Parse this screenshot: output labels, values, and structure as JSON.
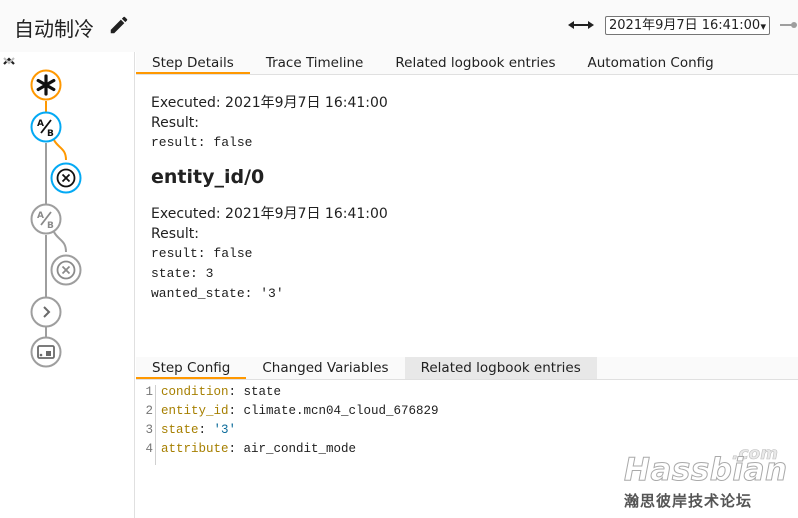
{
  "header": {
    "title": "自动制冷",
    "trace_select_value": "2021年9月7日 16:41:00",
    "icons": {
      "edit": "pencil-icon",
      "range": "double-arrow-icon",
      "next": "next-trace-icon"
    }
  },
  "graph": {
    "nodes": [
      {
        "type": "trigger",
        "icon": "asterisk-icon",
        "state": "active"
      },
      {
        "type": "condition",
        "icon": "choose-icon",
        "state": "active"
      },
      {
        "type": "stop",
        "icon": "close-icon",
        "state": "active"
      },
      {
        "type": "condition",
        "icon": "choose-icon",
        "state": "inactive"
      },
      {
        "type": "stop",
        "icon": "close-icon",
        "state": "inactive"
      },
      {
        "type": "action",
        "icon": "chevron-right-icon",
        "state": "inactive"
      },
      {
        "type": "device",
        "icon": "device-icon",
        "state": "inactive"
      }
    ],
    "colors": {
      "active": "#ff9800",
      "highlight": "#03a9f4",
      "inactive": "#9e9e9e"
    }
  },
  "top_tabs": [
    "Step Details",
    "Trace Timeline",
    "Related logbook entries",
    "Automation Config"
  ],
  "details": {
    "block1": {
      "executed": "Executed: 2021年9月7日 16:41:00",
      "result_label": "Result:",
      "lines": [
        "result: false"
      ]
    },
    "heading": "entity_id/0",
    "block2": {
      "executed": "Executed: 2021年9月7日 16:41:00",
      "result_label": "Result:",
      "lines": [
        "result: false",
        "state: 3",
        "wanted_state: '3'"
      ]
    }
  },
  "bottom_tabs": [
    "Step Config",
    "Changed Variables",
    "Related logbook entries"
  ],
  "config": {
    "lines": [
      {
        "num": "1",
        "key": "condition",
        "sep": ": ",
        "value": "state",
        "is_string": false
      },
      {
        "num": "2",
        "key": "entity_id",
        "sep": ": ",
        "value": "climate.mcn04_cloud_676829",
        "is_string": false
      },
      {
        "num": "3",
        "key": "state",
        "sep": ": ",
        "value": "'3'",
        "is_string": true
      },
      {
        "num": "4",
        "key": "attribute",
        "sep": ": ",
        "value": "air_condit_mode",
        "is_string": false
      }
    ]
  },
  "watermark": {
    "main": "Hassbian",
    "suffix": ".com",
    "sub": "瀚思彼岸技术论坛"
  }
}
